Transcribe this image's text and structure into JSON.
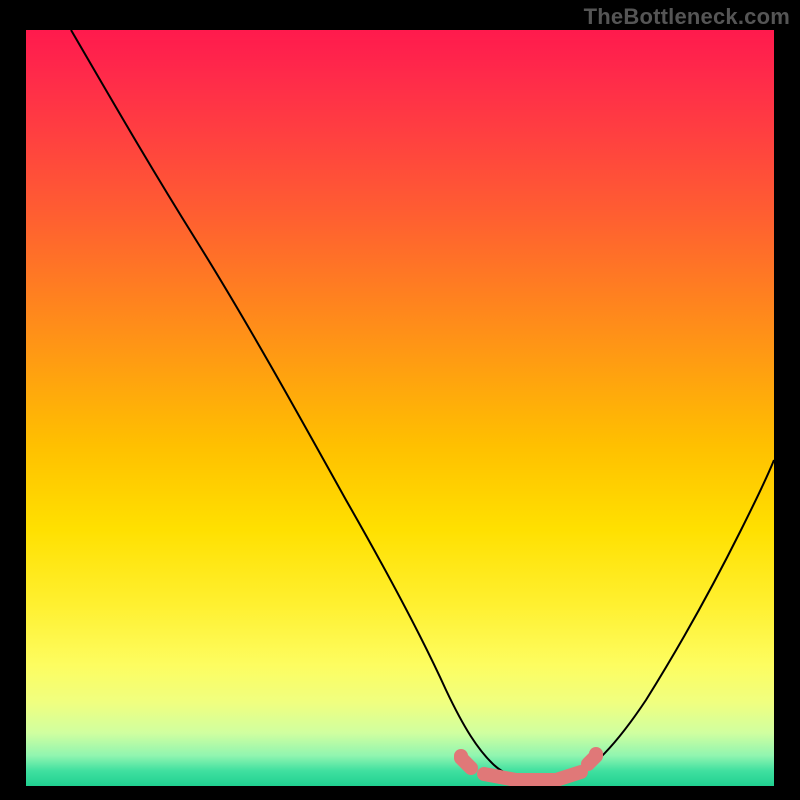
{
  "watermark": "TheBottleneck.com",
  "colors": {
    "marker": "#e07878",
    "curve": "#000000",
    "gradient_top": "#ff1a4d",
    "gradient_bottom": "#20d090"
  },
  "chart_data": {
    "type": "line",
    "title": "",
    "xlabel": "",
    "ylabel": "",
    "xlim": [
      0,
      100
    ],
    "ylim": [
      0,
      100
    ],
    "x": [
      6,
      10,
      15,
      20,
      25,
      30,
      35,
      40,
      45,
      50,
      55,
      58,
      60,
      63,
      66,
      70,
      74,
      78,
      82,
      86,
      90,
      95,
      100
    ],
    "values": [
      100,
      93,
      85,
      77,
      69,
      61,
      53,
      45,
      37,
      28,
      18,
      11,
      6,
      3,
      1.5,
      1,
      1.5,
      3,
      7,
      14,
      23,
      37,
      53
    ],
    "flat_region": {
      "x_start": 58,
      "x_end": 76,
      "y": 2
    },
    "annotations": [
      "TheBottleneck.com"
    ]
  }
}
